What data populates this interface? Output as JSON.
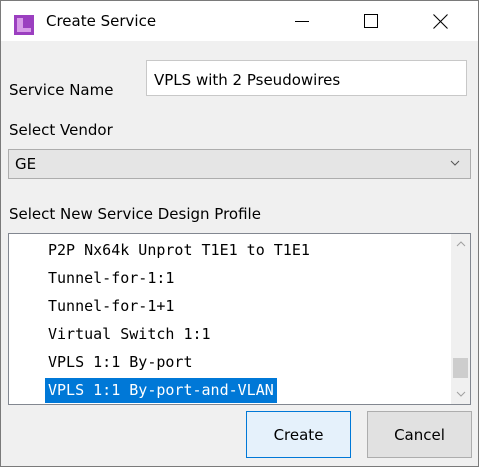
{
  "window": {
    "title": "Create Service",
    "icon": "app-window-icon",
    "controls": {
      "minimize": "minimize-icon",
      "maximize": "maximize-icon",
      "close": "close-icon"
    }
  },
  "service_name": {
    "label": "Service Name",
    "value": "VPLS with 2 Pseudowires"
  },
  "vendor": {
    "label": "Select Vendor",
    "selected": "GE"
  },
  "profile": {
    "label": "Select New Service Design Profile",
    "items": [
      "P2P Nx64k Unprot T1E1 to T1E1",
      "Tunnel-for-1:1",
      "Tunnel-for-1+1",
      "Virtual Switch 1:1",
      "VPLS 1:1 By-port",
      "VPLS 1:1 By-port-and-VLAN"
    ],
    "selected_index": 5
  },
  "buttons": {
    "create": "Create",
    "cancel": "Cancel"
  },
  "colors": {
    "accent": "#0078d7",
    "selection_text": "#ffffff",
    "icon_purple": "#9b3fc0"
  }
}
